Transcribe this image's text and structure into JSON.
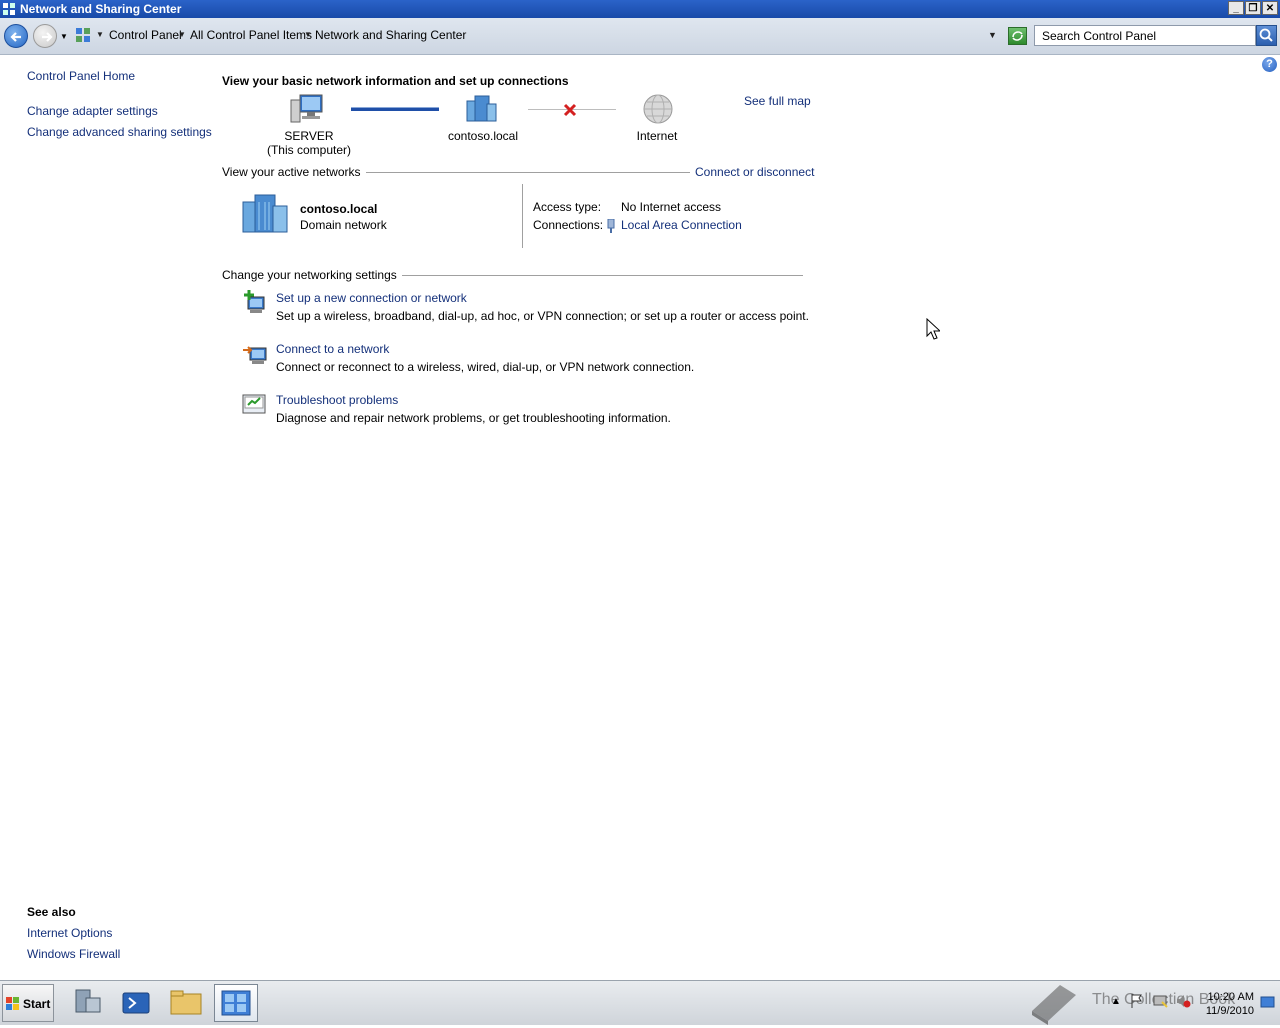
{
  "window": {
    "title": "Network and Sharing Center",
    "minimize": "_",
    "restore": "❐",
    "close": "✕"
  },
  "address": {
    "crumbs": [
      "Control Panel",
      "All Control Panel Items",
      "Network and Sharing Center"
    ],
    "search_placeholder": "Search Control Panel"
  },
  "help_label": "?",
  "left": {
    "home": "Control Panel Home",
    "links": [
      "Change adapter settings",
      "Change advanced sharing settings"
    ],
    "see_also_title": "See also",
    "see_also": [
      "Internet Options",
      "Windows Firewall"
    ]
  },
  "main": {
    "heading": "View your basic network information and set up connections",
    "see_full_map": "See full map",
    "map": {
      "computer_name": "SERVER",
      "computer_sub": "(This computer)",
      "network": "contoso.local",
      "internet": "Internet"
    },
    "active_networks_label": "View your active networks",
    "connect_disconnect": "Connect or disconnect",
    "active": {
      "name": "contoso.local",
      "category": "Domain network",
      "access_type_label": "Access type:",
      "access_type_value": "No Internet access",
      "connections_label": "Connections:",
      "connections_value": "Local Area Connection"
    },
    "change_settings_label": "Change your networking settings",
    "tasks": [
      {
        "title": "Set up a new connection or network",
        "desc": "Set up a wireless, broadband, dial-up, ad hoc, or VPN connection; or set up a router or access point."
      },
      {
        "title": "Connect to a network",
        "desc": "Connect or reconnect to a wireless, wired, dial-up, or VPN network connection."
      },
      {
        "title": "Troubleshoot problems",
        "desc": "Diagnose and repair network problems, or get troubleshooting information."
      }
    ]
  },
  "taskbar": {
    "start": "Start",
    "time": "10:20 AM",
    "date": "11/9/2010",
    "watermark": "The Collection Book"
  }
}
